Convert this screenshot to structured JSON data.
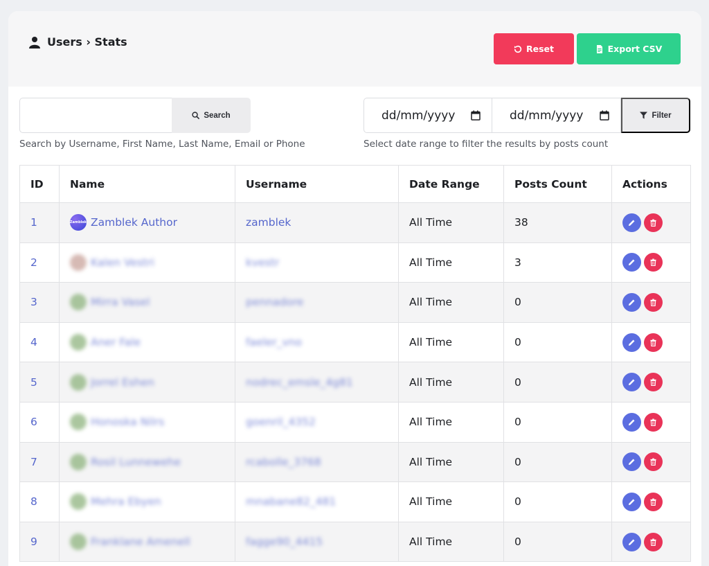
{
  "header": {
    "breadcrumb": "Users › Stats",
    "reset_label": "Reset",
    "export_label": "Export CSV"
  },
  "search": {
    "value": "",
    "button_label": "Search",
    "help": "Search by Username, First Name, Last Name, Email or Phone"
  },
  "date_filter": {
    "from": "dd/mm/yyyy",
    "to": "dd/mm/yyyy",
    "button_label": "Filter",
    "help": "Select date range to filter the results by posts count"
  },
  "table": {
    "columns": [
      "ID",
      "Name",
      "Username",
      "Date Range",
      "Posts Count",
      "Actions"
    ],
    "rows": [
      {
        "id": "1",
        "name": "Zamblek Author",
        "username": "zamblek",
        "range": "All Time",
        "posts": "38"
      },
      {
        "id": "2",
        "name": "Kalen Vestri",
        "username": "kvestr",
        "range": "All Time",
        "posts": "3"
      },
      {
        "id": "3",
        "name": "Mirra Vasel",
        "username": "pennadore",
        "range": "All Time",
        "posts": "0"
      },
      {
        "id": "4",
        "name": "Aner Fale",
        "username": "faeler_vno",
        "range": "All Time",
        "posts": "0"
      },
      {
        "id": "5",
        "name": "Jorrel Eshen",
        "username": "nodrec_emsle_4g81",
        "range": "All Time",
        "posts": "0"
      },
      {
        "id": "6",
        "name": "Honoska Nilrs",
        "username": "goenril_4352",
        "range": "All Time",
        "posts": "0"
      },
      {
        "id": "7",
        "name": "Rosil Lunnewehe",
        "username": "rcabolle_3768",
        "range": "All Time",
        "posts": "0"
      },
      {
        "id": "8",
        "name": "Mehra Ebyen",
        "username": "mnabane82_481",
        "range": "All Time",
        "posts": "0"
      },
      {
        "id": "9",
        "name": "Franklane Amenell",
        "username": "fagge90_4415",
        "range": "All Time",
        "posts": "0"
      }
    ]
  },
  "avatar_brand_text": "Zamblek",
  "colors": {
    "reset": "#f23a5a",
    "export": "#2ed18d",
    "edit": "#5b6de0",
    "delete": "#e93358",
    "link": "#5566cc"
  }
}
